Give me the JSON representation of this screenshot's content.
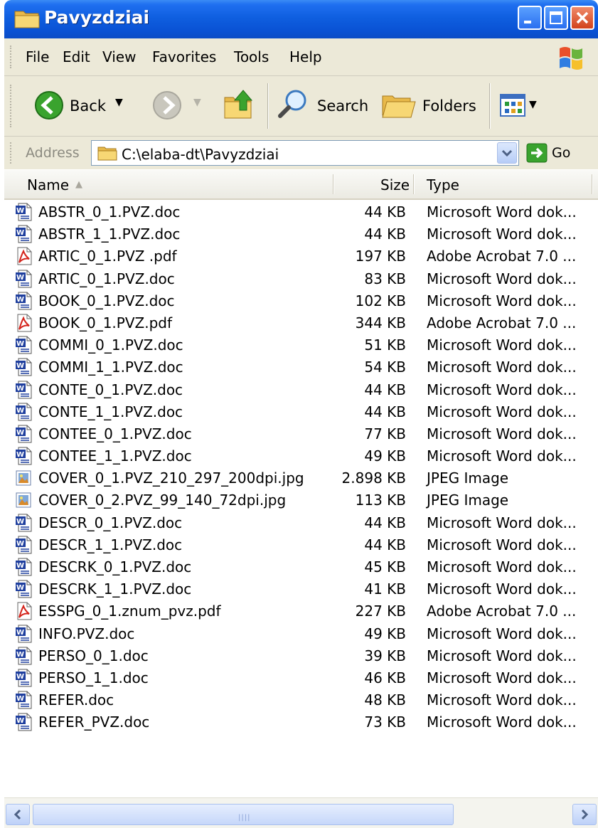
{
  "window": {
    "title": "Pavyzdziai"
  },
  "menu": [
    "File",
    "Edit",
    "View",
    "Favorites",
    "Tools",
    "Help"
  ],
  "toolbar": {
    "back": "Back",
    "search": "Search",
    "folders": "Folders"
  },
  "address": {
    "label": "Address",
    "path": "C:\\elaba-dt\\Pavyzdziai",
    "go": "Go"
  },
  "columns": {
    "name": "Name",
    "size": "Size",
    "type": "Type"
  },
  "files": [
    {
      "name": "ABSTR_0_1.PVZ.doc",
      "size": "44 KB",
      "type": "Microsoft Word dok...",
      "icon": "word-doc-icon"
    },
    {
      "name": "ABSTR_1_1.PVZ.doc",
      "size": "44 KB",
      "type": "Microsoft Word dok...",
      "icon": "word-doc-icon"
    },
    {
      "name": "ARTIC_0_1.PVZ .pdf",
      "size": "197 KB",
      "type": "Adobe Acrobat 7.0 ...",
      "icon": "pdf-icon"
    },
    {
      "name": "ARTIC_0_1.PVZ.doc",
      "size": "83 KB",
      "type": "Microsoft Word dok...",
      "icon": "word-doc-icon"
    },
    {
      "name": "BOOK_0_1.PVZ.doc",
      "size": "102 KB",
      "type": "Microsoft Word dok...",
      "icon": "word-doc-icon"
    },
    {
      "name": "BOOK_0_1.PVZ.pdf",
      "size": "344 KB",
      "type": "Adobe Acrobat 7.0 ...",
      "icon": "pdf-icon"
    },
    {
      "name": "COMMI_0_1.PVZ.doc",
      "size": "51 KB",
      "type": "Microsoft Word dok...",
      "icon": "word-doc-icon"
    },
    {
      "name": "COMMI_1_1.PVZ.doc",
      "size": "54 KB",
      "type": "Microsoft Word dok...",
      "icon": "word-doc-icon"
    },
    {
      "name": "CONTE_0_1.PVZ.doc",
      "size": "44 KB",
      "type": "Microsoft Word dok...",
      "icon": "word-doc-icon"
    },
    {
      "name": "CONTE_1_1.PVZ.doc",
      "size": "44 KB",
      "type": "Microsoft Word dok...",
      "icon": "word-doc-icon"
    },
    {
      "name": "CONTEE_0_1.PVZ.doc",
      "size": "77 KB",
      "type": "Microsoft Word dok...",
      "icon": "word-doc-icon"
    },
    {
      "name": "CONTEE_1_1.PVZ.doc",
      "size": "49 KB",
      "type": "Microsoft Word dok...",
      "icon": "word-doc-icon"
    },
    {
      "name": "COVER_0_1.PVZ_210_297_200dpi.jpg",
      "size": "2.898 KB",
      "type": "JPEG Image",
      "icon": "jpeg-image-icon"
    },
    {
      "name": "COVER_0_2.PVZ_99_140_72dpi.jpg",
      "size": "113 KB",
      "type": "JPEG Image",
      "icon": "jpeg-image-icon"
    },
    {
      "name": "DESCR_0_1.PVZ.doc",
      "size": "44 KB",
      "type": "Microsoft Word dok...",
      "icon": "word-doc-icon"
    },
    {
      "name": "DESCR_1_1.PVZ.doc",
      "size": "44 KB",
      "type": "Microsoft Word dok...",
      "icon": "word-doc-icon"
    },
    {
      "name": "DESCRK_0_1.PVZ.doc",
      "size": "45 KB",
      "type": "Microsoft Word dok...",
      "icon": "word-doc-icon"
    },
    {
      "name": "DESCRK_1_1.PVZ.doc",
      "size": "41 KB",
      "type": "Microsoft Word dok...",
      "icon": "word-doc-icon"
    },
    {
      "name": "ESSPG_0_1.znum_pvz.pdf",
      "size": "227 KB",
      "type": "Adobe Acrobat 7.0 ...",
      "icon": "pdf-icon"
    },
    {
      "name": "INFO.PVZ.doc",
      "size": "49 KB",
      "type": "Microsoft Word dok...",
      "icon": "word-doc-icon"
    },
    {
      "name": "PERSO_0_1.doc",
      "size": "39 KB",
      "type": "Microsoft Word dok...",
      "icon": "word-doc-icon"
    },
    {
      "name": "PERSO_1_1.doc",
      "size": "46 KB",
      "type": "Microsoft Word dok...",
      "icon": "word-doc-icon"
    },
    {
      "name": "REFER.doc",
      "size": "48 KB",
      "type": "Microsoft Word dok...",
      "icon": "word-doc-icon"
    },
    {
      "name": "REFER_PVZ.doc",
      "size": "73 KB",
      "type": "Microsoft Word dok...",
      "icon": "word-doc-icon"
    }
  ],
  "colors": {
    "titlebar": "#0a52d4",
    "chrome": "#ece9d8",
    "word_icon": "#1f3f9e",
    "pdf_icon": "#d4241c"
  }
}
